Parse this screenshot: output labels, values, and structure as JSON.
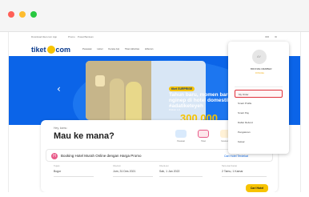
{
  "browser": {
    "dots": [
      {
        "name": "close",
        "color": "#ff5f57"
      },
      {
        "name": "minimize",
        "color": "#febc2e"
      },
      {
        "name": "maximize",
        "color": "#28c840"
      }
    ]
  },
  "site": {
    "utility_links": [
      "Download tiket.com App",
      "Promo",
      "Pusat Bantuan"
    ],
    "currency": "IDR",
    "language": "ID",
    "logo_text": "tiket",
    "logo_suffix": "com",
    "nav_links": [
      "Pesawat",
      "Hotel",
      "Kereta Api",
      "Tiket Aktivitas",
      "Hiburan"
    ],
    "nav_right": [
      "My Order",
      "My Account"
    ],
    "brand_color": "#0b64e8"
  },
  "hero": {
    "badge": "tiket SURPRISE",
    "headline": "Tahun baru, momen baru! Untuk nginep di hotel domestik. #adatiketeyeh",
    "subtext": "Diskon s.d",
    "amount": "300.000",
    "prev_arrow": "‹",
    "next_arrow": "›"
  },
  "search": {
    "greeting": "Hey, kamu",
    "headline": "Mau ke mana?",
    "product_tabs": [
      "Pesawat",
      "Hotel",
      "Kereta Api"
    ],
    "info_text": "Booking Hotel Murah Online dengan Harga Promo",
    "info_link": "Cari Hotel Terdekat",
    "fields": [
      {
        "label": "Tujuan",
        "value": "Bogor"
      },
      {
        "label": "Check-in",
        "value": "Jum, 31 Des 2021"
      },
      {
        "label": "Check-out",
        "value": "Sab, 1 Jan 2022"
      },
      {
        "label": "Tamu dan Kamar",
        "value": "2 Tamu, 1 Kamar"
      }
    ],
    "cta": "Cari Hotel"
  },
  "account_menu": {
    "avatar_initials": "AY",
    "member_label": "BRONZE MEMBER",
    "points_label": "0 Points",
    "items": [
      "My Order",
      "Smart Profile",
      "Smart Pay",
      "Daftar Refund",
      "Pengaturan",
      "Keluar"
    ],
    "highlighted_index": 0,
    "highlight_color": "#e0313c"
  }
}
